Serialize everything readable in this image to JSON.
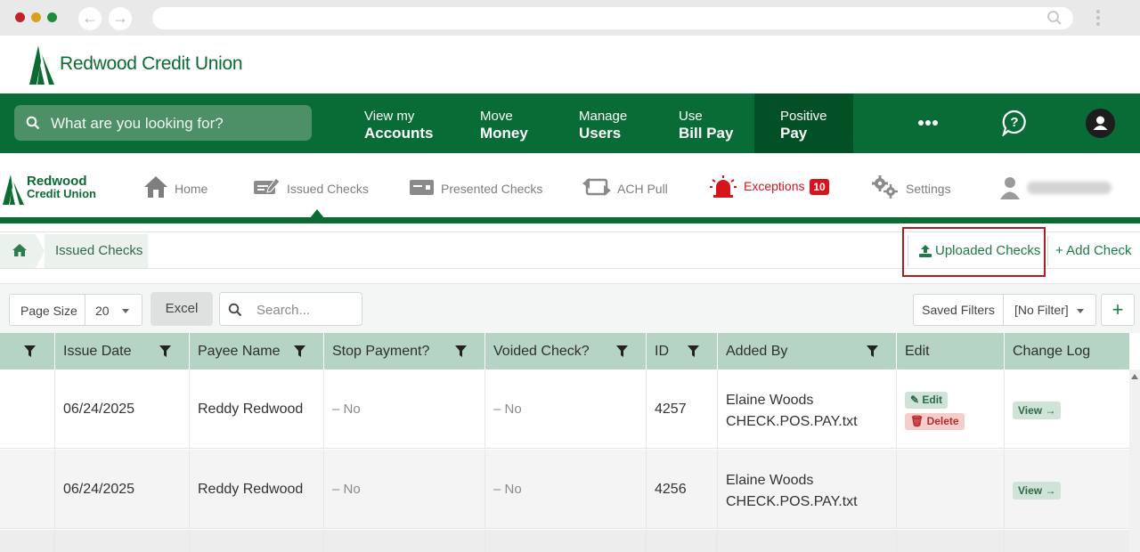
{
  "browser": {
    "dot_colors": [
      "#c0232a",
      "#d6a11f",
      "#1f8b3c"
    ]
  },
  "brand": {
    "name": "Redwood Credit Union",
    "color": "#0c6a33"
  },
  "main_nav": {
    "search_placeholder": "What are you looking for?",
    "items": [
      {
        "line1": "View my",
        "line2": "Accounts"
      },
      {
        "line1": "Move",
        "line2": "Money"
      },
      {
        "line1": "Manage",
        "line2": "Users"
      },
      {
        "line1": "Use",
        "line2": "Bill Pay"
      },
      {
        "line1": "Positive",
        "line2": "Pay"
      }
    ],
    "active_item": "Positive Pay",
    "icons": [
      "more-icon",
      "help-chat-icon",
      "user-avatar-icon"
    ]
  },
  "sub_nav": {
    "logo_line1": "Redwood",
    "logo_line2": "Credit Union",
    "tabs": [
      {
        "label": "Home",
        "icon": "home-icon"
      },
      {
        "label": "Issued Checks",
        "icon": "check-pen-icon"
      },
      {
        "label": "Presented Checks",
        "icon": "card-icon"
      },
      {
        "label": "ACH Pull",
        "icon": "transfer-icon"
      },
      {
        "label": "Exceptions",
        "icon": "alarm-icon",
        "badge": "10"
      },
      {
        "label": "Settings",
        "icon": "gears-icon"
      }
    ],
    "active_tab": "Issued Checks",
    "exceptions_color": "#d6141c"
  },
  "breadcrumb": {
    "current": "Issued Checks"
  },
  "actions": {
    "uploaded_checks": "Uploaded Checks",
    "add_check": "+ Add Check"
  },
  "toolbar": {
    "page_size_label": "Page Size",
    "page_size_value": "20",
    "excel": "Excel",
    "search_placeholder": "Search...",
    "saved_filters": "Saved Filters",
    "filter_value": "[No Filter]",
    "add_filter": "+"
  },
  "grid": {
    "columns": [
      "",
      "Issue Date",
      "Payee Name",
      "Stop Payment?",
      "Voided Check?",
      "ID",
      "Added By",
      "Edit",
      "Change Log"
    ],
    "header_color": "#b5d4c3",
    "rows": [
      {
        "issue_date": "06/24/2025",
        "payee": "Reddy Redwood",
        "stop_payment": "– No",
        "voided": "– No",
        "id": "4257",
        "added_by": "Elaine Woods",
        "added_file": "CHECK.POS.PAY.txt",
        "edit": "Edit",
        "delete": "Delete",
        "change_log": "View →"
      },
      {
        "issue_date": "06/24/2025",
        "payee": "Reddy Redwood",
        "stop_payment": "– No",
        "voided": "– No",
        "id": "4256",
        "added_by": "Elaine Woods",
        "added_file": "CHECK.POS.PAY.txt",
        "change_log": "View →"
      }
    ]
  }
}
